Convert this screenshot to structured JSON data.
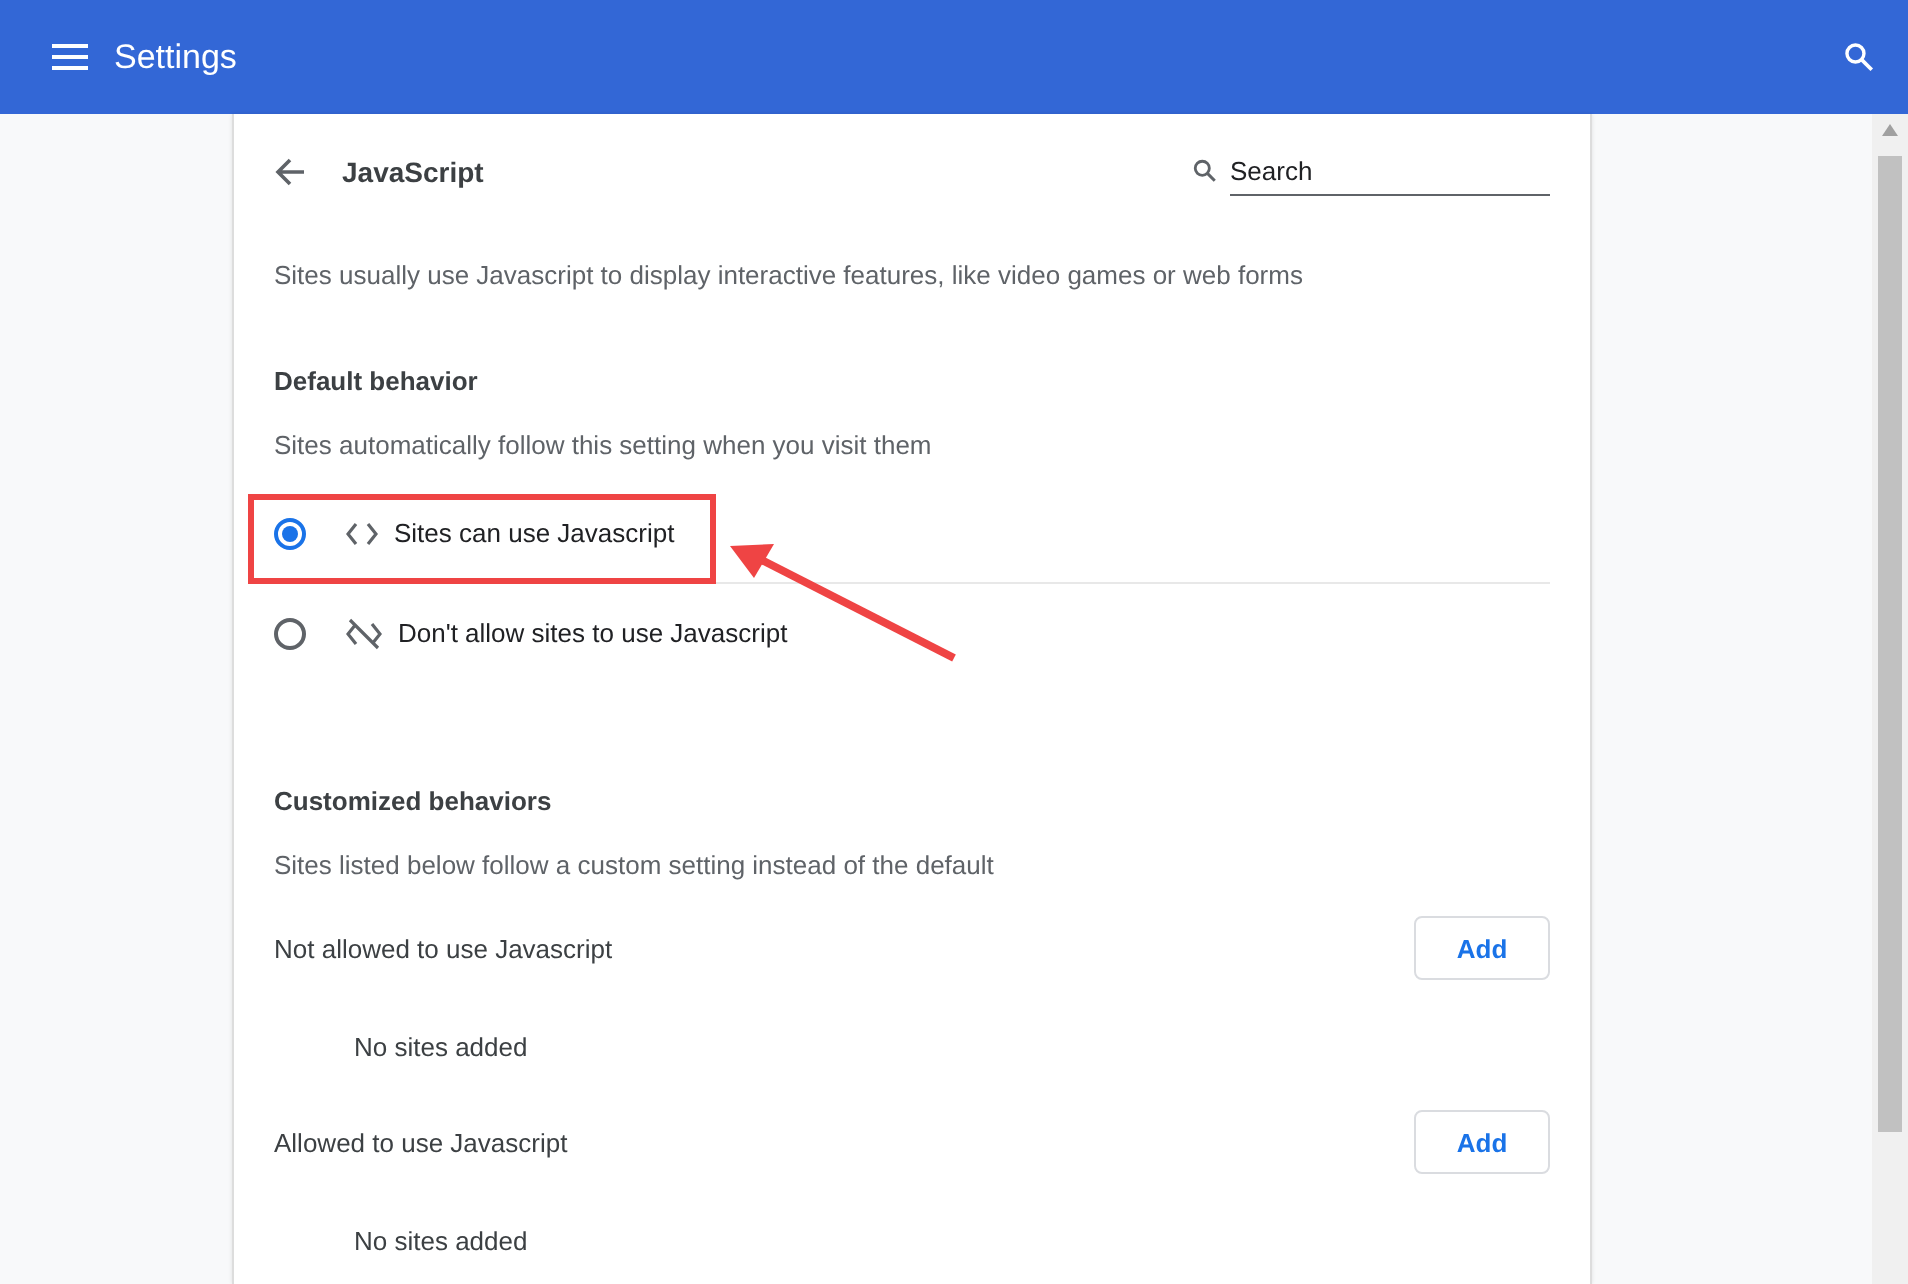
{
  "header": {
    "title": "Settings"
  },
  "page": {
    "title": "JavaScript",
    "search": {
      "placeholder": "Search"
    },
    "description": "Sites usually use Javascript to display interactive features, like video games or web forms"
  },
  "default_behavior": {
    "heading": "Default behavior",
    "subtitle": "Sites automatically follow this setting when you visit them",
    "options": [
      {
        "kind": "allow",
        "label": "Sites can use Javascript",
        "selected": true,
        "highlighted": true
      },
      {
        "kind": "block",
        "label": "Don't allow sites to use Javascript",
        "selected": false,
        "highlighted": false
      }
    ]
  },
  "customized": {
    "heading": "Customized behaviors",
    "subtitle": "Sites listed below follow a custom setting instead of the default",
    "lists": [
      {
        "label": "Not allowed to use Javascript",
        "button": "Add",
        "empty": "No sites added"
      },
      {
        "label": "Allowed to use Javascript",
        "button": "Add",
        "empty": "No sites added"
      }
    ]
  }
}
